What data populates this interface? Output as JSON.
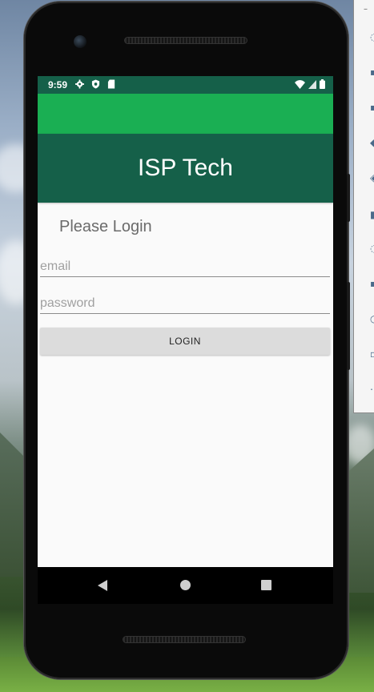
{
  "status_bar": {
    "time": "9:59",
    "icons": [
      "gear-icon",
      "shield-icon",
      "sd-card-icon"
    ],
    "right_icons": [
      "wifi-icon",
      "signal-icon",
      "battery-icon"
    ]
  },
  "app": {
    "title": "ISP Tech",
    "header_color": "#156049",
    "toolbar_color": "#1aaf53"
  },
  "login": {
    "subtitle": "Please Login",
    "email_placeholder": "email",
    "password_placeholder": "password",
    "button_label": "LOGIN"
  },
  "nav": {
    "items": [
      "back-icon",
      "home-icon",
      "recents-icon"
    ]
  }
}
